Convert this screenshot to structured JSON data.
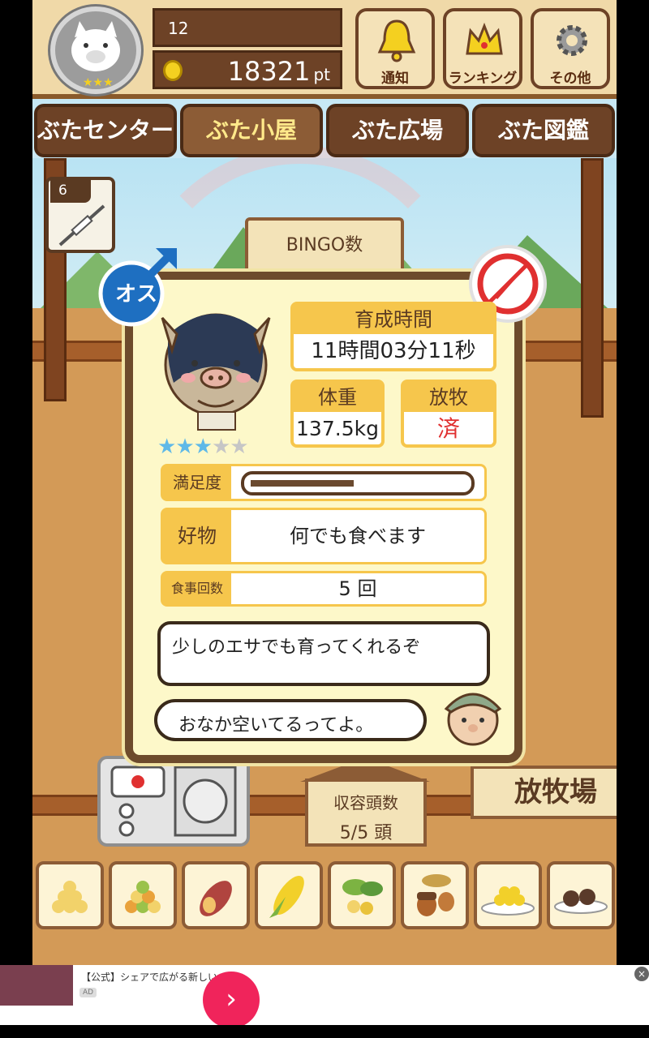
{
  "header": {
    "level": "12",
    "points": "18321",
    "points_unit": "pt",
    "buttons": [
      {
        "label": "通知",
        "icon": "bell-icon"
      },
      {
        "label": "ランキング",
        "icon": "crown-icon"
      },
      {
        "label": "その他",
        "icon": "gear-icon"
      }
    ]
  },
  "tabs": [
    "ぶたセンター",
    "ぶた小屋",
    "ぶた広場",
    "ぶた図鑑"
  ],
  "active_tab": "ぶた小屋",
  "item_card": {
    "count": "6",
    "icon": "syringe-icon"
  },
  "background_sign": "BINGO数",
  "pig_info": {
    "gender_label": "オス",
    "gender_icon": "male-symbol-icon",
    "status_icon": "no-injection-icon",
    "rarity_stars": 3,
    "rarity_max": 5,
    "raising_time_label": "育成時間",
    "raising_time": "11時間03分11秒",
    "weight_label": "体重",
    "weight": "137.5kg",
    "grazing_label": "放牧",
    "grazing_status": "済",
    "satisfaction_label": "満足度",
    "satisfaction_level": 0.48,
    "favorite_label": "好物",
    "favorite": "何でも食べます",
    "meals_label": "食事回数",
    "meals": "5 回",
    "description": "少しのエサでも育ってくれるぞ",
    "farmer_message": "おなか空いてるってよ。"
  },
  "bottom": {
    "capacity_label": "収容頭数",
    "capacity_value": "5/5 頭",
    "pasture_label": "放牧場"
  },
  "foods": [
    "grain-icon",
    "mixed-grain-icon",
    "sweet-potato-icon",
    "corn-icon",
    "vegetable-mix-icon",
    "acorn-icon",
    "grain-plate-icon",
    "meat-plate-icon"
  ],
  "ad": {
    "text": "【公式】シェアで広がる新しい...",
    "label": "AD"
  },
  "colors": {
    "wood_dark": "#6d4226",
    "panel_yellow": "#f6c64c",
    "popup_bg": "#fdf8c9",
    "status_red": "#e03030",
    "star_blue": "#5fb9e8"
  }
}
